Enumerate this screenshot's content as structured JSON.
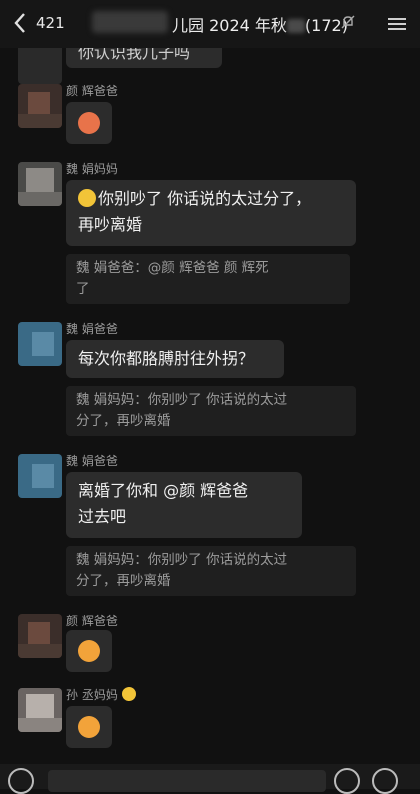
{
  "header": {
    "back_badge": "421",
    "title": "儿园 2024 年秋",
    "member_count": "(172)"
  },
  "messages": [
    {
      "type": "fragment",
      "text": "你认识我儿子吗"
    },
    {
      "type": "emoji",
      "sender": "颜 辉爸爸",
      "emoji": "angry-face"
    },
    {
      "type": "text",
      "sender": "魏 娟妈妈",
      "lines": [
        "你别吵了 你话说的太过分了，",
        "再吵离婚"
      ],
      "quote": {
        "lines": [
          "魏 娟爸爸：@颜 辉爸爸  颜 辉死",
          "了"
        ]
      }
    },
    {
      "type": "text",
      "sender": "魏 娟爸爸",
      "lines": [
        "每次你都胳膊肘往外拐？"
      ],
      "quote": {
        "lines": [
          "魏 娟妈妈：你别吵了 你话说的太过",
          "分了，再吵离婚"
        ]
      }
    },
    {
      "type": "text",
      "sender": "魏 娟爸爸",
      "lines": [
        "离婚了你和 @颜 辉爸爸",
        "过去吧"
      ],
      "quote": {
        "lines": [
          "魏 娟妈妈：你别吵了 你话说的太过",
          "分了，再吵离婚"
        ]
      }
    },
    {
      "type": "emoji",
      "sender": "颜 辉爸爸",
      "emoji": "sleepy-face"
    },
    {
      "type": "emoji",
      "sender": "孙 丞妈妈",
      "emoji": "facepalm-face"
    }
  ]
}
